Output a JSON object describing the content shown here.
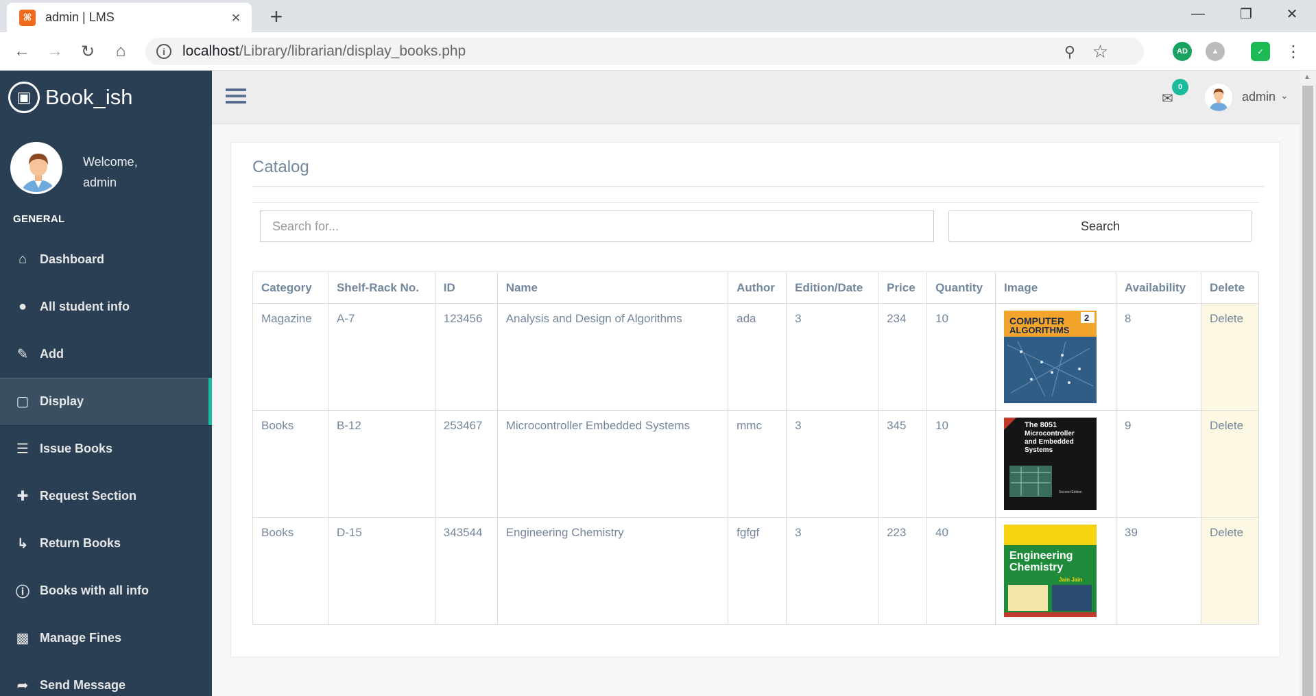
{
  "browser": {
    "tab_title": "admin | LMS",
    "favicon_text": "⌘",
    "url_host": "localhost",
    "url_path": "/Library/librarian/display_books.php",
    "ext_ad": "AD"
  },
  "sidebar": {
    "brand": "Book_ish",
    "welcome": "Welcome,",
    "username": "admin",
    "section": "GENERAL",
    "items": [
      {
        "label": "Dashboard",
        "icon": "home-icon"
      },
      {
        "label": "All student info",
        "icon": "user-icon"
      },
      {
        "label": "Add",
        "icon": "edit-icon"
      },
      {
        "label": "Display",
        "icon": "desktop-icon",
        "active": true
      },
      {
        "label": "Issue Books",
        "icon": "list-icon"
      },
      {
        "label": "Request Section",
        "icon": "plus-icon"
      },
      {
        "label": "Return Books",
        "icon": "level-down-icon"
      },
      {
        "label": "Books with all info",
        "icon": "info-icon"
      },
      {
        "label": "Manage Fines",
        "icon": "money-icon"
      },
      {
        "label": "Send Message",
        "icon": "share-icon"
      }
    ]
  },
  "topnav": {
    "mail_count": "0",
    "user": "admin"
  },
  "catalog": {
    "title": "Catalog",
    "search_placeholder": "Search for...",
    "search_button": "Search",
    "columns": [
      "Category",
      "Shelf-Rack No.",
      "ID",
      "Name",
      "Author",
      "Edition/Date",
      "Price",
      "Quantity",
      "Image",
      "Availability",
      "Delete"
    ],
    "rows": [
      {
        "category": "Magazine",
        "shelf": "A-7",
        "id": "123456",
        "name": "Analysis and Design of Algorithms",
        "author": "ada",
        "edition": "3",
        "price": "234",
        "quantity": "10",
        "cover": "COMPUTER ALGORITHMS",
        "availability": "8",
        "delete": "Delete"
      },
      {
        "category": "Books",
        "shelf": "B-12",
        "id": "253467",
        "name": "Microcontroller Embedded Systems",
        "author": "mmc",
        "edition": "3",
        "price": "345",
        "quantity": "10",
        "cover": "The 8051 Microcontroller and Embedded Systems",
        "availability": "9",
        "delete": "Delete"
      },
      {
        "category": "Books",
        "shelf": "D-15",
        "id": "343544",
        "name": "Engineering Chemistry",
        "author": "fgfgf",
        "edition": "3",
        "price": "223",
        "quantity": "40",
        "cover": "Engineering Chemistry",
        "availability": "39",
        "delete": "Delete"
      }
    ]
  },
  "colors": {
    "sidebar_bg": "#2a3f54",
    "accent": "#1abb9c",
    "text": "#73879c",
    "delete_bg": "#fcf8e3"
  }
}
